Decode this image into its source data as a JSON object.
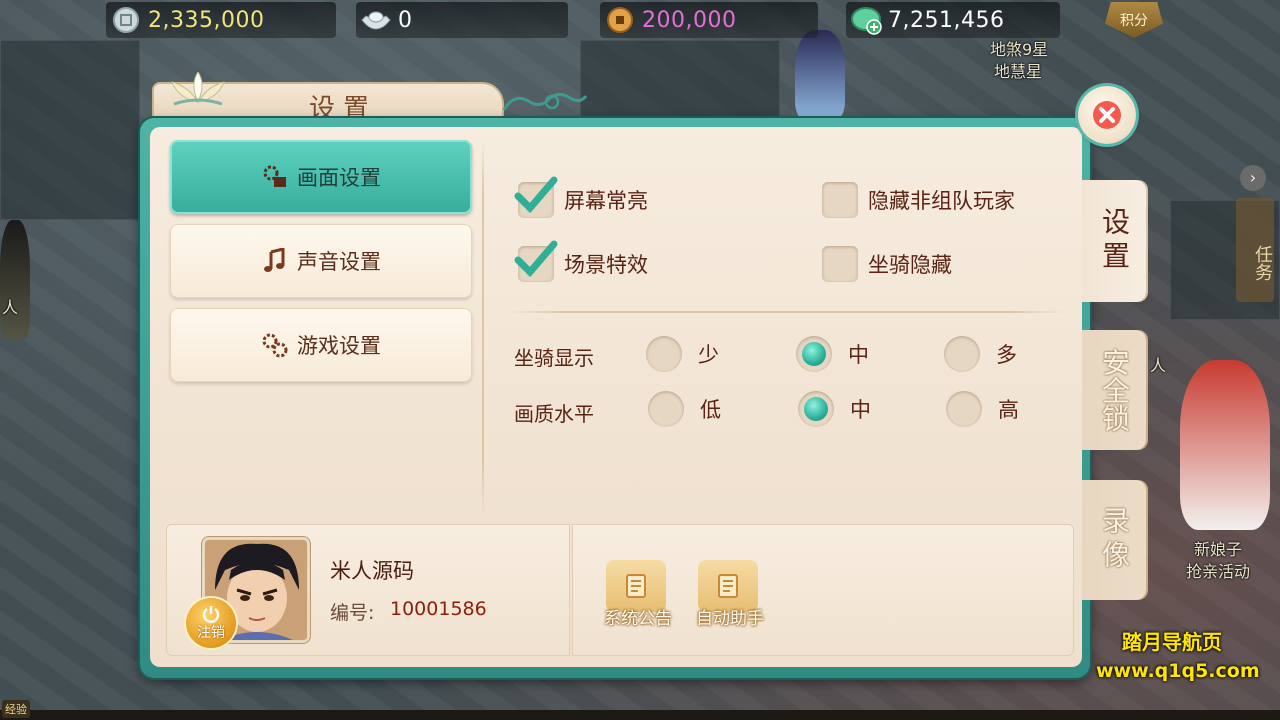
{
  "resources": [
    {
      "icon": "silver-coin-icon",
      "value": "2,335,000",
      "color": "#f1e57a"
    },
    {
      "icon": "silver-ingot-icon",
      "value": "0",
      "color": "#ffffff"
    },
    {
      "icon": "copper-coin-icon",
      "value": "200,000",
      "color": "#e56fd9"
    },
    {
      "icon": "jade-add-icon",
      "value": "7,251,456",
      "color": "#ffffff"
    }
  ],
  "jifen_label": "积分",
  "world": {
    "npc1_name_a": "地煞9星",
    "npc1_name_b": "地慧星",
    "npc2_name_a": "新娘子",
    "npc2_name_b": "抢亲活动",
    "quest_tab": "任务",
    "left_npc": "人",
    "right_npc": "人"
  },
  "dialog": {
    "title": "设置",
    "menu": [
      {
        "label": "画面设置",
        "icon": "gear-screen-icon",
        "active": true
      },
      {
        "label": "声音设置",
        "icon": "music-note-icon",
        "active": false
      },
      {
        "label": "游戏设置",
        "icon": "gears-icon",
        "active": false
      }
    ],
    "checkboxes": [
      {
        "label": "屏幕常亮",
        "checked": true
      },
      {
        "label": "隐藏非组队玩家",
        "checked": false
      },
      {
        "label": "场景特效",
        "checked": true
      },
      {
        "label": "坐骑隐藏",
        "checked": false
      }
    ],
    "mount_display": {
      "label": "坐骑显示",
      "options": [
        "少",
        "中",
        "多"
      ],
      "selected": "中"
    },
    "quality": {
      "label": "画质水平",
      "options": [
        "低",
        "中",
        "高"
      ],
      "selected": "中"
    },
    "player": {
      "name": "米人源码",
      "id_label": "编号:",
      "id": "10001586",
      "logout_label": "注销"
    },
    "functions": [
      {
        "label": "系统公告",
        "icon": "scroll-icon"
      },
      {
        "label": "自动助手",
        "icon": "scroll-icon"
      }
    ],
    "side_tabs": [
      {
        "label": "设置",
        "active": true
      },
      {
        "label": "安全锁",
        "active": false
      },
      {
        "label": "录像",
        "active": false
      }
    ]
  },
  "watermark": {
    "line1": "踏月导航页",
    "line2": "www.q1q5.com"
  },
  "exp_label": "经验"
}
